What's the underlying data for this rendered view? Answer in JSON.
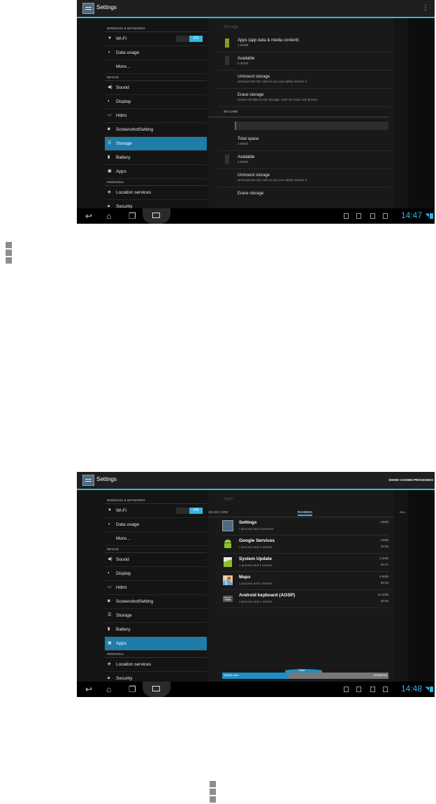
{
  "screen1": {
    "app_title": "Settings",
    "overflow_icon": "overflow-menu-icon",
    "sidebar": {
      "sections": [
        {
          "header": "WIRELESS & NETWORKS",
          "items": [
            {
              "label": "Wi-Fi",
              "icon": "wifi-icon",
              "toggle": "ON"
            },
            {
              "label": "Data usage",
              "icon": "data-usage-icon"
            },
            {
              "label": "More...",
              "icon": ""
            }
          ]
        },
        {
          "header": "DEVICE",
          "items": [
            {
              "label": "Sound",
              "icon": "sound-icon"
            },
            {
              "label": "Display",
              "icon": "display-icon"
            },
            {
              "label": "Hdmi",
              "icon": "hdmi-icon"
            },
            {
              "label": "ScreenshotSetting",
              "icon": "screenshot-icon"
            },
            {
              "label": "Storage",
              "icon": "storage-icon",
              "active": true
            },
            {
              "label": "Battery",
              "icon": "battery-icon"
            },
            {
              "label": "Apps",
              "icon": "apps-icon"
            }
          ]
        },
        {
          "header": "PERSONAL",
          "items": [
            {
              "label": "Location services",
              "icon": "location-icon"
            },
            {
              "label": "Security",
              "icon": "lock-icon"
            }
          ]
        }
      ]
    },
    "detail": {
      "header": "Storage",
      "rows": [
        {
          "title": "Apps (app data & media content)",
          "sub": "1.06MB",
          "swatch": "green"
        },
        {
          "title": "Available",
          "sub": "5.45GB",
          "swatch": "gray"
        },
        {
          "title": "Unmount storage",
          "sub": "Unmount the SD card so you can safely remove it"
        },
        {
          "title": "Erase storage",
          "sub": "Erases all data on the storage, such as music and photos"
        }
      ],
      "sd_header": "SD CARD",
      "sd_rows": [
        {
          "title": "Total space",
          "sub": "3.69GB"
        },
        {
          "title": "Available",
          "sub": "3.68GB",
          "swatch": "gray"
        },
        {
          "title": "Unmount storage",
          "sub": "Unmount the SD card so you can safely remove it"
        },
        {
          "title": "Erase storage",
          "sub": ""
        }
      ]
    },
    "clock": "14:47"
  },
  "screen2": {
    "app_title": "Settings",
    "show_cached": "SHOW CACHED PROCESSES",
    "sidebar_active": "Apps",
    "detail": {
      "header": "Apps",
      "tabs": [
        "ON SD CARD",
        "RUNNING",
        "ALL"
      ],
      "active_tab": "RUNNING",
      "apps": [
        {
          "name": "Settings",
          "sub": "1 process and 0 services",
          "mem": "23MB",
          "time": "",
          "icon": "settings-app-icon"
        },
        {
          "name": "Google Services",
          "sub": "1 process and 1 service",
          "mem": "12MB",
          "time": "34:58",
          "icon": "android-icon"
        },
        {
          "name": "System Update",
          "sub": "1 process and 1 service",
          "mem": "3.4MB",
          "time": "34:57",
          "icon": "system-update-icon"
        },
        {
          "name": "Maps",
          "sub": "1 process and 1 service",
          "mem": "6.9MB",
          "time": "35:30",
          "icon": "maps-icon"
        },
        {
          "name": "Android keyboard (AOSP)",
          "sub": "1 process and 1 service",
          "mem": "10.0MB",
          "time": "35:06",
          "icon": "keyboard-icon"
        }
      ],
      "ram": {
        "label": "RAM",
        "used": "256MB used",
        "free": "629MB free",
        "used_fraction": 0.4
      }
    },
    "clock": "14:48"
  },
  "colors": {
    "accent": "#33b5e5",
    "selected": "#1e7ca8",
    "storage_green": "#829c27"
  }
}
